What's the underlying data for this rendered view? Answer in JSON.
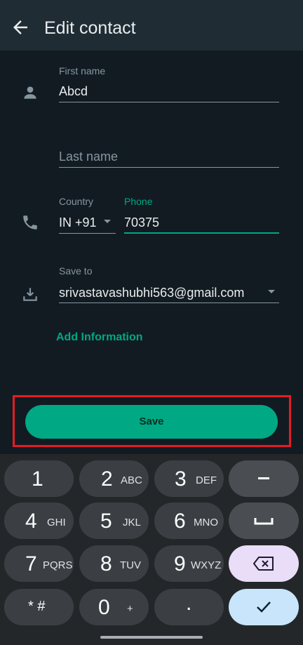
{
  "header": {
    "title": "Edit contact"
  },
  "form": {
    "first_name": {
      "label": "First name",
      "value": "Abcd"
    },
    "last_name": {
      "placeholder": "Last name"
    },
    "country": {
      "label": "Country",
      "value": "IN +91"
    },
    "phone": {
      "label": "Phone",
      "value": "70375"
    },
    "save_to": {
      "label": "Save to",
      "value": "srivastavashubhi563@gmail.com"
    },
    "add_info_label": "Add Information"
  },
  "save_label": "Save",
  "keypad": {
    "keys": [
      {
        "digit": "1",
        "letters": ""
      },
      {
        "digit": "2",
        "letters": "ABC"
      },
      {
        "digit": "3",
        "letters": "DEF"
      },
      {
        "digit": "4",
        "letters": "GHI"
      },
      {
        "digit": "5",
        "letters": "JKL"
      },
      {
        "digit": "6",
        "letters": "MNO"
      },
      {
        "digit": "7",
        "letters": "PQRS"
      },
      {
        "digit": "8",
        "letters": "TUV"
      },
      {
        "digit": "9",
        "letters": "WXYZ"
      },
      {
        "digit": "* #",
        "letters": ""
      },
      {
        "digit": "0",
        "letters": "+"
      },
      {
        "digit": ".",
        "letters": ""
      }
    ]
  },
  "colors": {
    "accent": "#00a884",
    "highlight": "#e31c25",
    "background": "#121b22"
  }
}
